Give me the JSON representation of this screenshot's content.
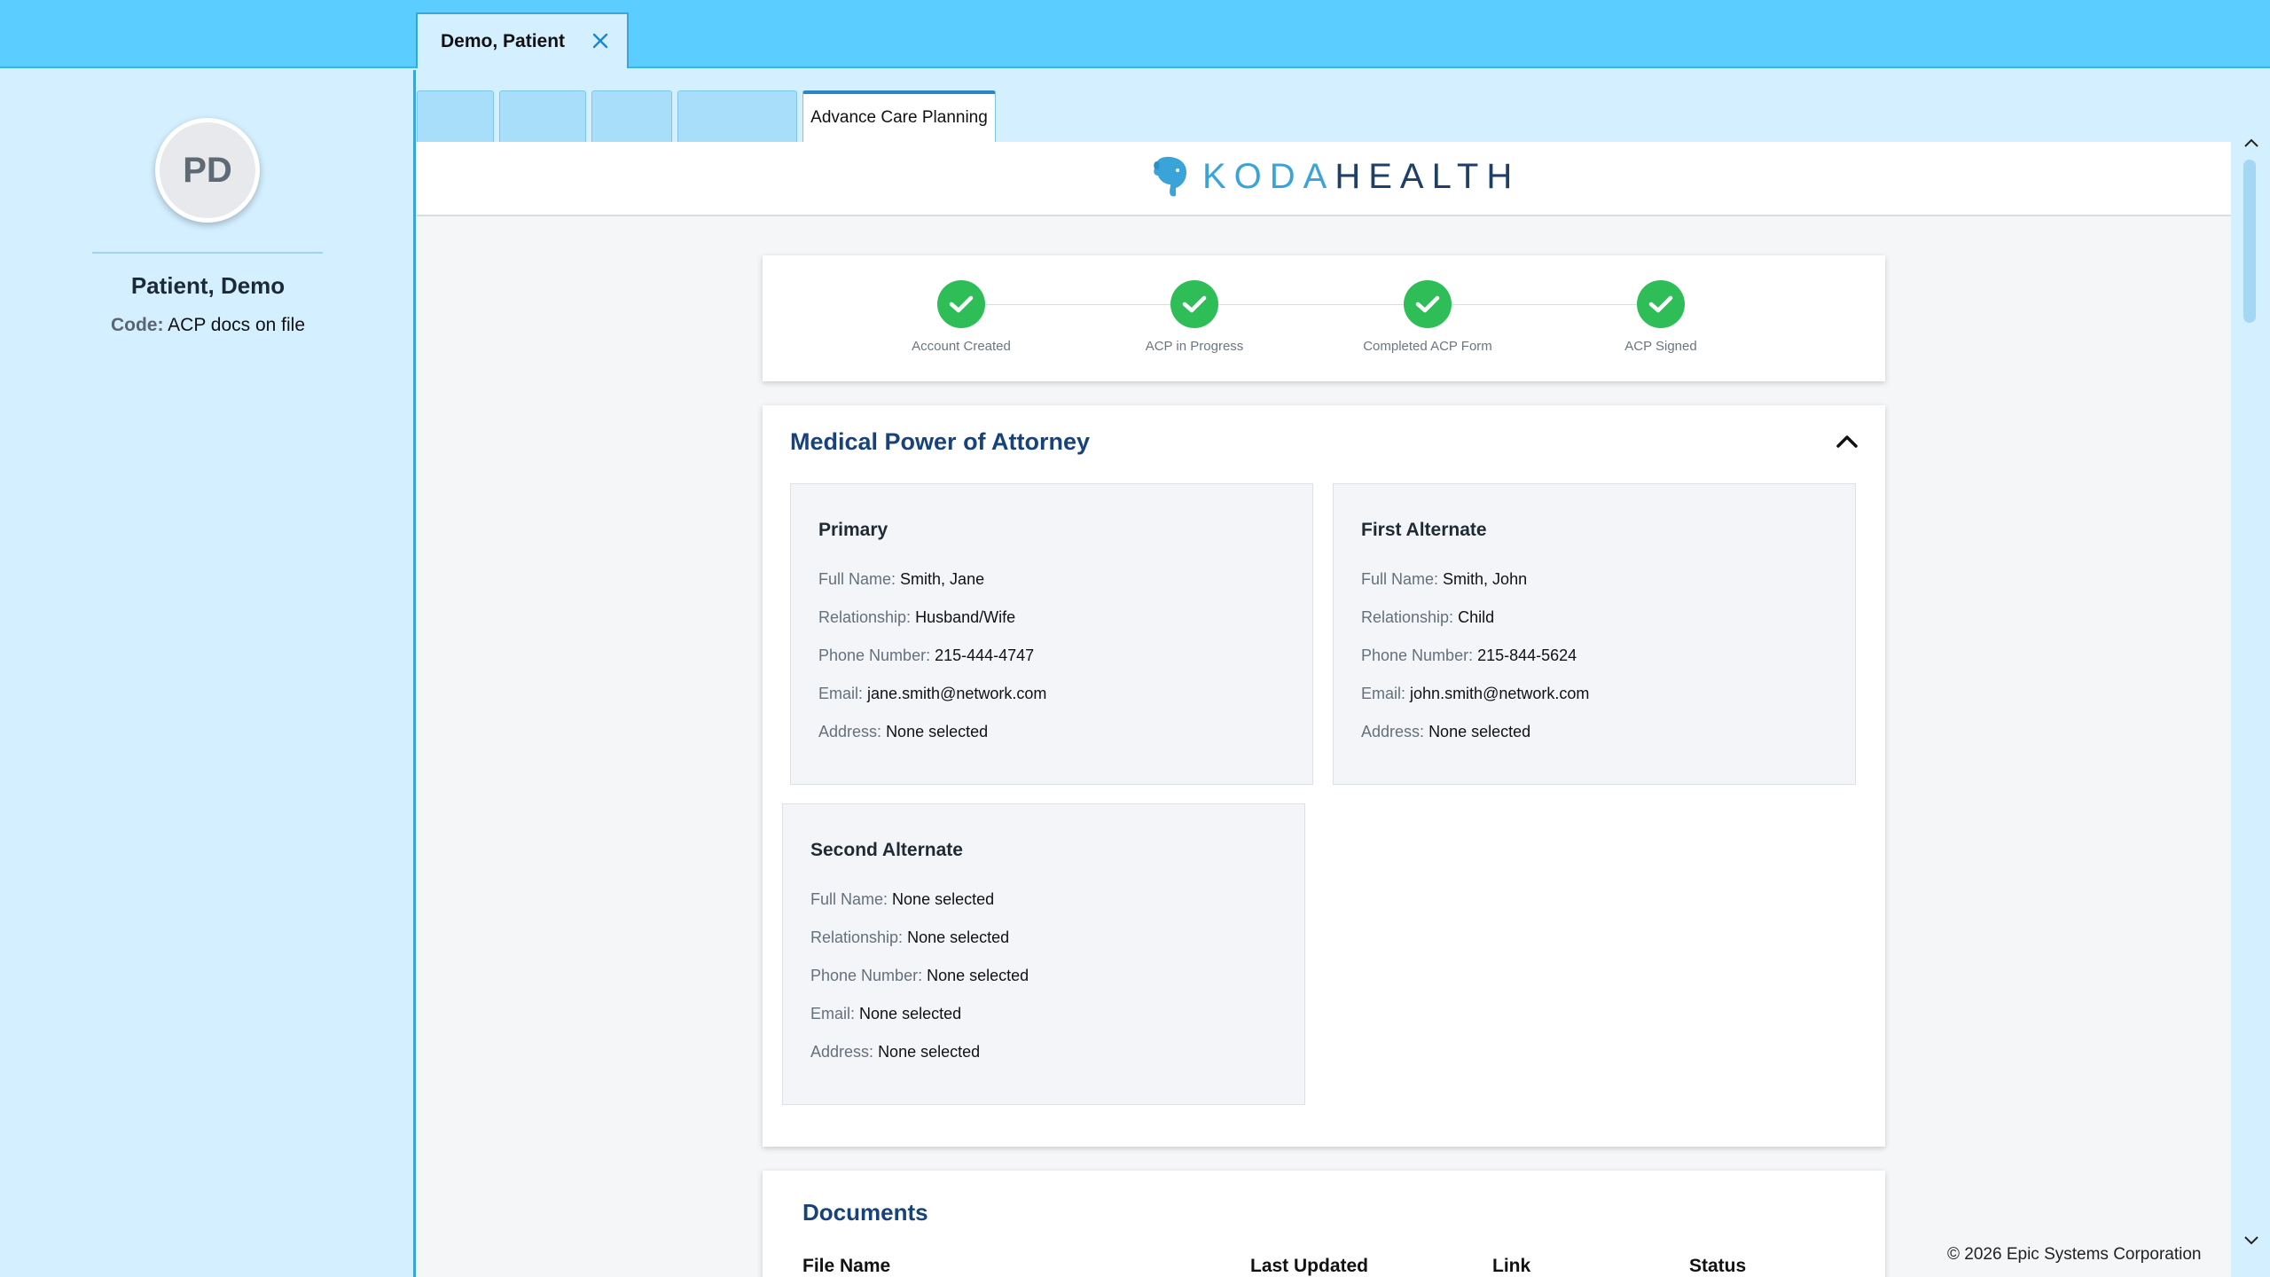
{
  "patient_tab": {
    "label": "Demo, Patient",
    "close_icon": "close-icon"
  },
  "patient": {
    "initials": "PD",
    "name": "Patient, Demo",
    "code_key": "Code:",
    "code_value": "ACP docs on file"
  },
  "activity_tabs": [
    {
      "label": ""
    },
    {
      "label": ""
    },
    {
      "label": ""
    },
    {
      "label": ""
    },
    {
      "label": "Advance Care Planning",
      "active": true
    }
  ],
  "logo": {
    "word1": "KODA",
    "word2": "HEALTH",
    "icon": "elephant-icon"
  },
  "progress": {
    "steps": [
      {
        "label": "Account Created",
        "done": true
      },
      {
        "label": "ACP in Progress",
        "done": true
      },
      {
        "label": "Completed ACP Form",
        "done": true
      },
      {
        "label": "ACP Signed",
        "done": true
      }
    ]
  },
  "mpoa": {
    "title": "Medical Power of Attorney",
    "labels": {
      "full_name": "Full Name:",
      "relationship": "Relationship:",
      "phone": "Phone Number:",
      "email": "Email:",
      "address": "Address:"
    },
    "agents": [
      {
        "title": "Primary",
        "full_name": "Smith, Jane",
        "relationship": "Husband/Wife",
        "phone": "215-444-4747",
        "email": "jane.smith@network.com",
        "address": "None selected"
      },
      {
        "title": "First Alternate",
        "full_name": "Smith, John",
        "relationship": "Child",
        "phone": "215-844-5624",
        "email": "john.smith@network.com",
        "address": "None selected"
      },
      {
        "title": "Second Alternate",
        "full_name": "None selected",
        "relationship": "None selected",
        "phone": "None selected",
        "email": "None selected",
        "address": "None selected"
      }
    ]
  },
  "documents": {
    "title": "Documents",
    "columns": [
      "File Name",
      "Last Updated",
      "Link",
      "Status"
    ]
  },
  "footer": {
    "copyright": "© 2026 Epic Systems Corporation"
  },
  "colors": {
    "topbar": "#5bcdff",
    "success": "#2fbd58",
    "heading": "#17427a",
    "brand_light": "#3aa4d9",
    "brand_dark": "#1e3f66"
  }
}
